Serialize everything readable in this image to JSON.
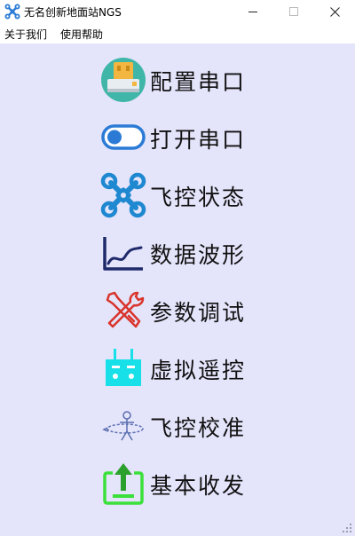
{
  "window": {
    "title": "无名创新地面站NGS"
  },
  "menu": {
    "items": [
      "关于我们",
      "使用帮助"
    ]
  },
  "buttons": [
    {
      "label": "配置串口",
      "icon": "usb-drive-icon"
    },
    {
      "label": "打开串口",
      "icon": "toggle-switch-icon"
    },
    {
      "label": "飞控状态",
      "icon": "quadcopter-icon"
    },
    {
      "label": "数据波形",
      "icon": "line-chart-icon"
    },
    {
      "label": "参数调试",
      "icon": "wrench-screwdriver-icon"
    },
    {
      "label": "虚拟遥控",
      "icon": "remote-controller-icon"
    },
    {
      "label": "飞控校准",
      "icon": "calibration-icon"
    },
    {
      "label": "基本收发",
      "icon": "upload-tray-icon"
    }
  ],
  "colors": {
    "content_bg": "#e4e4fb",
    "accent_blue": "#2b7bd6",
    "usb_yellow": "#f3b640",
    "chart_navy": "#1f2a6b",
    "tool_red": "#d9342b",
    "remote_cyan": "#18e0e8",
    "tray_green": "#3be03b"
  }
}
